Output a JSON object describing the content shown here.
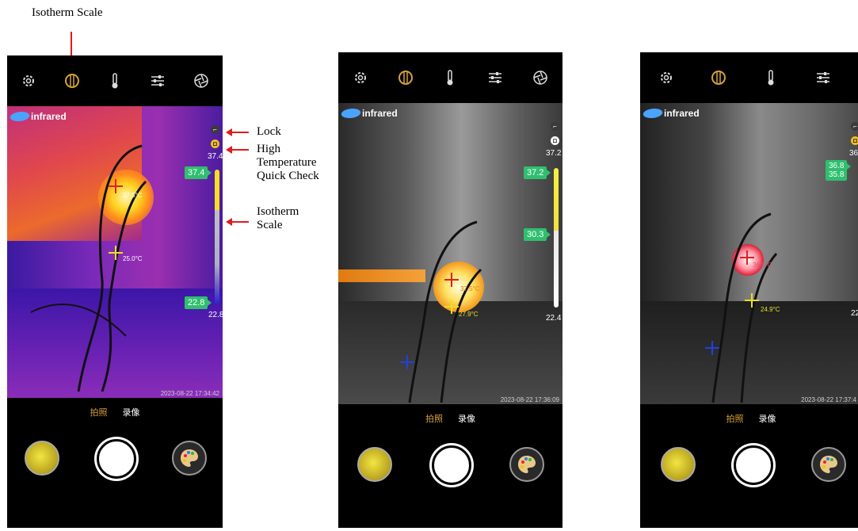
{
  "figure_title": "Isotherm Scale",
  "annotations": {
    "lock": "Lock",
    "high_temp_line1": "High",
    "high_temp_line2": "Temperature",
    "high_temp_line3": "Quick Check",
    "isotherm_line1": "Isotherm",
    "isotherm_line2": "Scale"
  },
  "brand": "infrared",
  "modes": {
    "photo": "拍照",
    "video": "录像"
  },
  "toolbar_icons": [
    "settings-icon",
    "isotherm-icon",
    "thermometer-icon",
    "sliders-icon",
    "aperture-icon"
  ],
  "colors": {
    "accent": "#d9a23a",
    "tag": "#2fbf6f",
    "arrow": "#e01b1b"
  },
  "screens": [
    {
      "palette": "iron",
      "max_temp": "37.4",
      "upper_tag": "37.4",
      "lower_tag": "22.8",
      "min_temp": "22.8",
      "hot_spot": "37.5°C",
      "center_temp": "25.0°C",
      "timestamp": "2023-08-22 17:34:42"
    },
    {
      "palette": "white-hot",
      "max_temp": "37.2",
      "upper_tag": "37.2",
      "lower_tag": "30.3",
      "min_temp": "22.4",
      "hot_spot": "37.5°C",
      "center_temp": "27.9°C",
      "timestamp": "2023-08-22 17:36:09"
    },
    {
      "palette": "grayscale",
      "max_temp": "36",
      "upper_tag": "36.8",
      "lower_tag": "35.8",
      "min_temp": "22",
      "hot_spot": "36.5°C",
      "center_temp": "24.9°C",
      "timestamp": "2023-08-22 17:37:4"
    }
  ]
}
